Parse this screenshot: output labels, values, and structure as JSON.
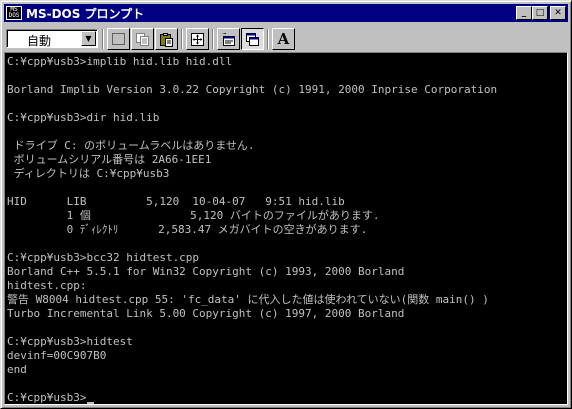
{
  "window": {
    "title": "MS-DOS プロンプト",
    "icon_label_top": "MS",
    "icon_label_bottom": "DOS"
  },
  "title_buttons": {
    "minimize": "_",
    "maximize": "□",
    "close": "✕"
  },
  "toolbar": {
    "font_select_value": "自動",
    "font_button_label": "A",
    "buttons": [
      "mark-icon",
      "copy-icon",
      "paste-icon",
      "fullscreen-icon",
      "properties-icon",
      "background-icon",
      "font-icon"
    ]
  },
  "console": {
    "lines": [
      "C:¥cpp¥usb3>implib hid.lib hid.dll",
      "",
      "Borland Implib Version 3.0.22 Copyright (c) 1991, 2000 Inprise Corporation",
      "",
      "C:¥cpp¥usb3>dir hid.lib",
      "",
      " ドライブ C: のボリュームラベルはありません.",
      " ボリュームシリアル番号は 2A66-1EE1",
      " ディレクトリは C:¥cpp¥usb3",
      "",
      "HID      LIB         5,120  10-04-07   9:51 hid.lib",
      "         1 個               5,120 バイトのファイルがあります.",
      "         0 ﾃﾞｨﾚｸﾄﾘ      2,583.47 メガバイトの空きがあります.",
      "",
      "C:¥cpp¥usb3>bcc32 hidtest.cpp",
      "Borland C++ 5.5.1 for Win32 Copyright (c) 1993, 2000 Borland",
      "hidtest.cpp:",
      "警告 W8004 hidtest.cpp 55: 'fc_data' に代入した値は使われていない(関数 main() )",
      "Turbo Incremental Link 5.00 Copyright (c) 1997, 2000 Borland",
      "",
      "C:¥cpp¥usb3>hidtest",
      "devinf=00C907B0",
      "end",
      "",
      "C:¥cpp¥usb3>"
    ]
  },
  "colors": {
    "titlebar": "#000080",
    "console_bg": "#000000",
    "console_fg": "#c0c0c0",
    "chrome": "#c0c0c0"
  }
}
